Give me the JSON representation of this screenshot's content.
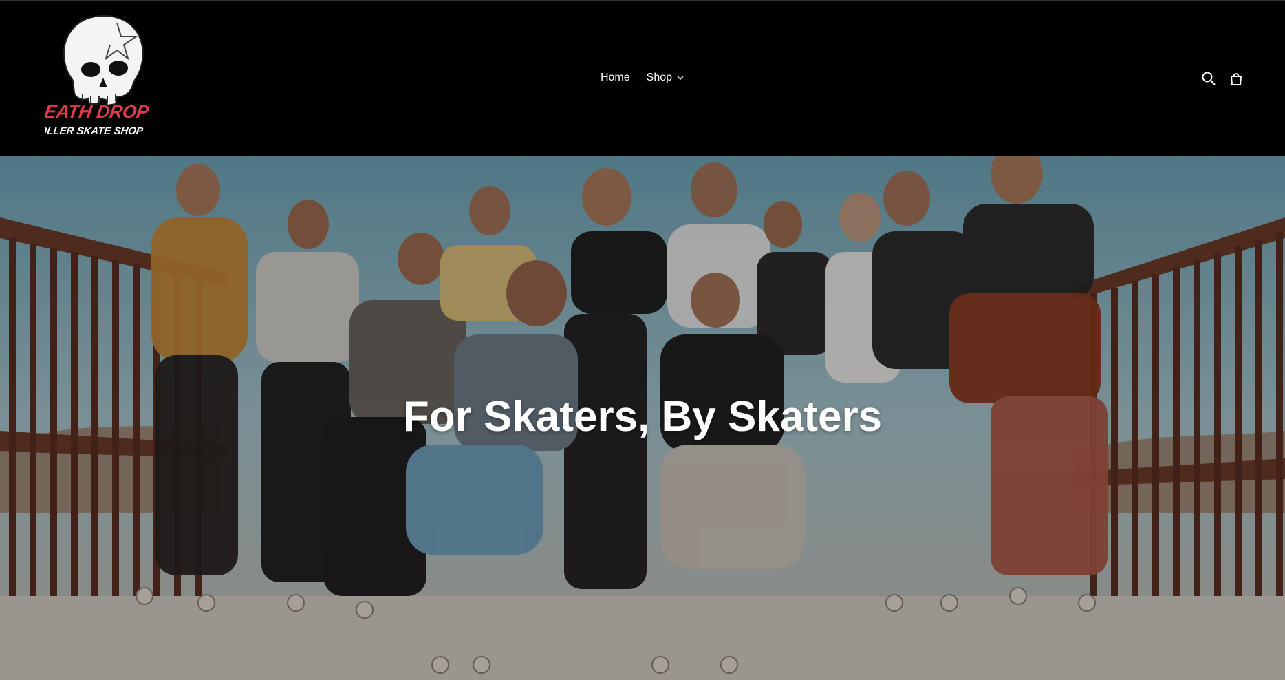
{
  "brand": {
    "name_line1": "DEATH DROP",
    "name_line2": "ROLLER SKATE SHOP",
    "logo_icon": "skull-icon",
    "accent_color": "#e23a4a"
  },
  "nav": {
    "items": [
      {
        "label": "Home",
        "active": true
      },
      {
        "label": "Shop",
        "has_dropdown": true
      }
    ]
  },
  "header_icons": {
    "search": "search-icon",
    "cart": "cart-icon"
  },
  "hero": {
    "title": "For Skaters, By Skaters",
    "image": "group-of-roller-skaters-on-bridge"
  }
}
